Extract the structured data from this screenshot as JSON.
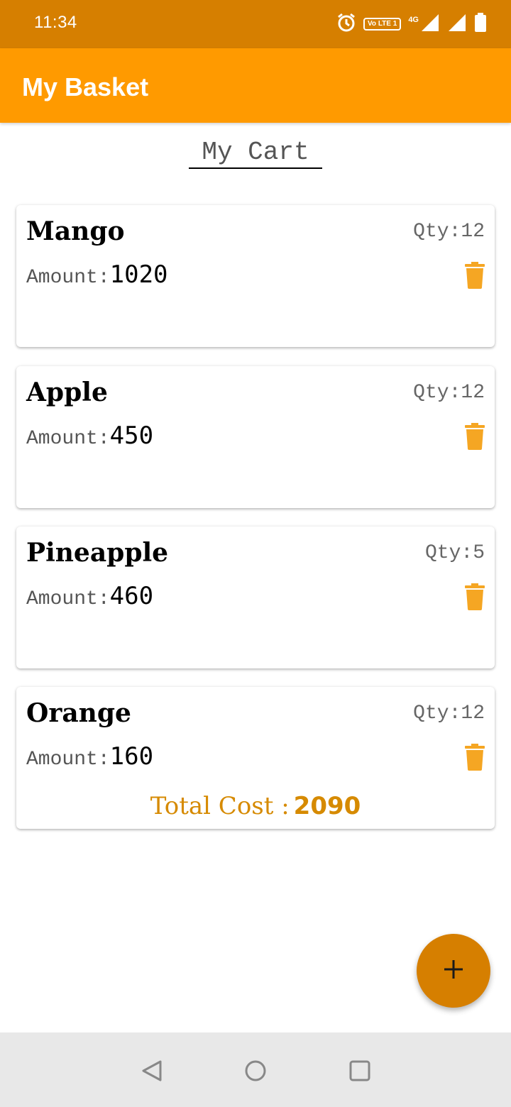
{
  "status_bar": {
    "time": "11:34",
    "volte_label": "Vo LTE 1",
    "network_label": "4G",
    "icons": [
      "alarm-icon",
      "volte-icon",
      "signal-icon",
      "signal-icon",
      "battery-icon"
    ]
  },
  "app_bar": {
    "title": "My Basket"
  },
  "cart_heading": "My Cart",
  "labels": {
    "qty": "Qty:",
    "amount": "Amount:"
  },
  "items": [
    {
      "name": "Mango",
      "qty": "12",
      "amount": "1020"
    },
    {
      "name": "Apple",
      "qty": "12",
      "amount": "450"
    },
    {
      "name": "Pineapple",
      "qty": "5",
      "amount": "460"
    },
    {
      "name": "Orange",
      "qty": "12",
      "amount": "160"
    }
  ],
  "total": {
    "label": "Total Cost :",
    "value": "2090"
  },
  "fab": {
    "icon": "plus-icon"
  },
  "nav": {
    "icons": [
      "back-icon",
      "home-icon",
      "recents-icon"
    ]
  },
  "colors": {
    "status_bar": "#d67f00",
    "app_bar": "#ff9a00",
    "accent": "#f5a623",
    "total_text": "#d68a00"
  }
}
